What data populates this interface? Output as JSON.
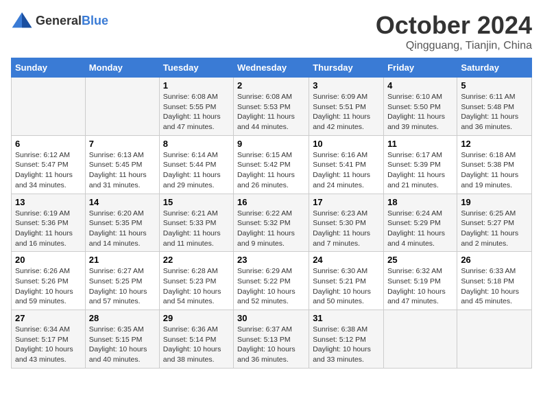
{
  "header": {
    "logo_general": "General",
    "logo_blue": "Blue",
    "month": "October 2024",
    "location": "Qingguang, Tianjin, China"
  },
  "weekdays": [
    "Sunday",
    "Monday",
    "Tuesday",
    "Wednesday",
    "Thursday",
    "Friday",
    "Saturday"
  ],
  "weeks": [
    [
      {
        "day": "",
        "sunrise": "",
        "sunset": "",
        "daylight": ""
      },
      {
        "day": "",
        "sunrise": "",
        "sunset": "",
        "daylight": ""
      },
      {
        "day": "1",
        "sunrise": "Sunrise: 6:08 AM",
        "sunset": "Sunset: 5:55 PM",
        "daylight": "Daylight: 11 hours and 47 minutes."
      },
      {
        "day": "2",
        "sunrise": "Sunrise: 6:08 AM",
        "sunset": "Sunset: 5:53 PM",
        "daylight": "Daylight: 11 hours and 44 minutes."
      },
      {
        "day": "3",
        "sunrise": "Sunrise: 6:09 AM",
        "sunset": "Sunset: 5:51 PM",
        "daylight": "Daylight: 11 hours and 42 minutes."
      },
      {
        "day": "4",
        "sunrise": "Sunrise: 6:10 AM",
        "sunset": "Sunset: 5:50 PM",
        "daylight": "Daylight: 11 hours and 39 minutes."
      },
      {
        "day": "5",
        "sunrise": "Sunrise: 6:11 AM",
        "sunset": "Sunset: 5:48 PM",
        "daylight": "Daylight: 11 hours and 36 minutes."
      }
    ],
    [
      {
        "day": "6",
        "sunrise": "Sunrise: 6:12 AM",
        "sunset": "Sunset: 5:47 PM",
        "daylight": "Daylight: 11 hours and 34 minutes."
      },
      {
        "day": "7",
        "sunrise": "Sunrise: 6:13 AM",
        "sunset": "Sunset: 5:45 PM",
        "daylight": "Daylight: 11 hours and 31 minutes."
      },
      {
        "day": "8",
        "sunrise": "Sunrise: 6:14 AM",
        "sunset": "Sunset: 5:44 PM",
        "daylight": "Daylight: 11 hours and 29 minutes."
      },
      {
        "day": "9",
        "sunrise": "Sunrise: 6:15 AM",
        "sunset": "Sunset: 5:42 PM",
        "daylight": "Daylight: 11 hours and 26 minutes."
      },
      {
        "day": "10",
        "sunrise": "Sunrise: 6:16 AM",
        "sunset": "Sunset: 5:41 PM",
        "daylight": "Daylight: 11 hours and 24 minutes."
      },
      {
        "day": "11",
        "sunrise": "Sunrise: 6:17 AM",
        "sunset": "Sunset: 5:39 PM",
        "daylight": "Daylight: 11 hours and 21 minutes."
      },
      {
        "day": "12",
        "sunrise": "Sunrise: 6:18 AM",
        "sunset": "Sunset: 5:38 PM",
        "daylight": "Daylight: 11 hours and 19 minutes."
      }
    ],
    [
      {
        "day": "13",
        "sunrise": "Sunrise: 6:19 AM",
        "sunset": "Sunset: 5:36 PM",
        "daylight": "Daylight: 11 hours and 16 minutes."
      },
      {
        "day": "14",
        "sunrise": "Sunrise: 6:20 AM",
        "sunset": "Sunset: 5:35 PM",
        "daylight": "Daylight: 11 hours and 14 minutes."
      },
      {
        "day": "15",
        "sunrise": "Sunrise: 6:21 AM",
        "sunset": "Sunset: 5:33 PM",
        "daylight": "Daylight: 11 hours and 11 minutes."
      },
      {
        "day": "16",
        "sunrise": "Sunrise: 6:22 AM",
        "sunset": "Sunset: 5:32 PM",
        "daylight": "Daylight: 11 hours and 9 minutes."
      },
      {
        "day": "17",
        "sunrise": "Sunrise: 6:23 AM",
        "sunset": "Sunset: 5:30 PM",
        "daylight": "Daylight: 11 hours and 7 minutes."
      },
      {
        "day": "18",
        "sunrise": "Sunrise: 6:24 AM",
        "sunset": "Sunset: 5:29 PM",
        "daylight": "Daylight: 11 hours and 4 minutes."
      },
      {
        "day": "19",
        "sunrise": "Sunrise: 6:25 AM",
        "sunset": "Sunset: 5:27 PM",
        "daylight": "Daylight: 11 hours and 2 minutes."
      }
    ],
    [
      {
        "day": "20",
        "sunrise": "Sunrise: 6:26 AM",
        "sunset": "Sunset: 5:26 PM",
        "daylight": "Daylight: 10 hours and 59 minutes."
      },
      {
        "day": "21",
        "sunrise": "Sunrise: 6:27 AM",
        "sunset": "Sunset: 5:25 PM",
        "daylight": "Daylight: 10 hours and 57 minutes."
      },
      {
        "day": "22",
        "sunrise": "Sunrise: 6:28 AM",
        "sunset": "Sunset: 5:23 PM",
        "daylight": "Daylight: 10 hours and 54 minutes."
      },
      {
        "day": "23",
        "sunrise": "Sunrise: 6:29 AM",
        "sunset": "Sunset: 5:22 PM",
        "daylight": "Daylight: 10 hours and 52 minutes."
      },
      {
        "day": "24",
        "sunrise": "Sunrise: 6:30 AM",
        "sunset": "Sunset: 5:21 PM",
        "daylight": "Daylight: 10 hours and 50 minutes."
      },
      {
        "day": "25",
        "sunrise": "Sunrise: 6:32 AM",
        "sunset": "Sunset: 5:19 PM",
        "daylight": "Daylight: 10 hours and 47 minutes."
      },
      {
        "day": "26",
        "sunrise": "Sunrise: 6:33 AM",
        "sunset": "Sunset: 5:18 PM",
        "daylight": "Daylight: 10 hours and 45 minutes."
      }
    ],
    [
      {
        "day": "27",
        "sunrise": "Sunrise: 6:34 AM",
        "sunset": "Sunset: 5:17 PM",
        "daylight": "Daylight: 10 hours and 43 minutes."
      },
      {
        "day": "28",
        "sunrise": "Sunrise: 6:35 AM",
        "sunset": "Sunset: 5:15 PM",
        "daylight": "Daylight: 10 hours and 40 minutes."
      },
      {
        "day": "29",
        "sunrise": "Sunrise: 6:36 AM",
        "sunset": "Sunset: 5:14 PM",
        "daylight": "Daylight: 10 hours and 38 minutes."
      },
      {
        "day": "30",
        "sunrise": "Sunrise: 6:37 AM",
        "sunset": "Sunset: 5:13 PM",
        "daylight": "Daylight: 10 hours and 36 minutes."
      },
      {
        "day": "31",
        "sunrise": "Sunrise: 6:38 AM",
        "sunset": "Sunset: 5:12 PM",
        "daylight": "Daylight: 10 hours and 33 minutes."
      },
      {
        "day": "",
        "sunrise": "",
        "sunset": "",
        "daylight": ""
      },
      {
        "day": "",
        "sunrise": "",
        "sunset": "",
        "daylight": ""
      }
    ]
  ]
}
